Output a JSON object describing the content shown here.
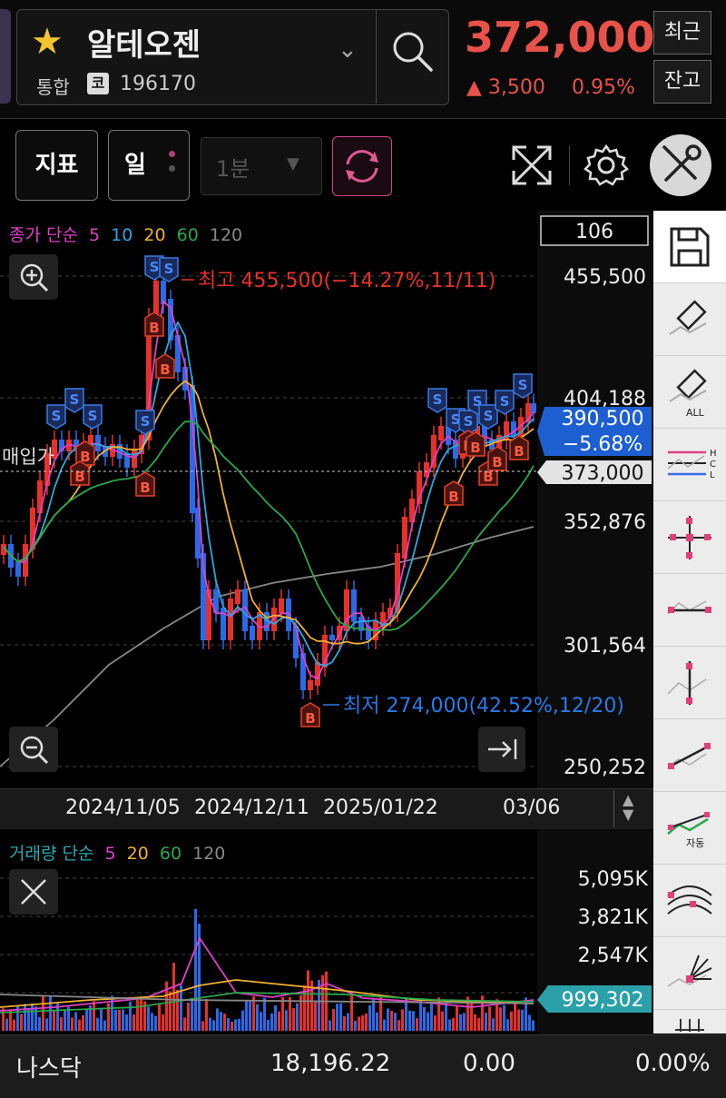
{
  "header": {
    "stock_name": "알테오젠",
    "market": "통합",
    "code_badge": "코",
    "code": "196170",
    "price": "372,000",
    "change": "▲ 3,500",
    "change_pct": "0.95%",
    "recent_btn": "최근",
    "balance_btn": "잔고"
  },
  "toolbar": {
    "indicator_btn": "지표",
    "period_btn": "일",
    "interval_select": "1분"
  },
  "chart": {
    "ma_label_prefix": "종가 단순",
    "ma_periods": [
      "5",
      "10",
      "20",
      "60",
      "120"
    ],
    "ma_colors": [
      "#e040c8",
      "#2aa8e0",
      "#f0b030",
      "#29a84a",
      "#888888"
    ],
    "top_count": "106",
    "price_ticks": [
      "455,500",
      "404,188",
      "352,876",
      "301,564",
      "250,252"
    ],
    "high_label": "최고 455,500(−14.27%,11/11)",
    "low_label": "최저 274,000(42.52%,12/20)",
    "current_tag_price": "390,500",
    "current_tag_pct": "−5.68%",
    "buy_price_label": "매입가",
    "buy_price_tag": "373,000",
    "dates": [
      "2024/11/05",
      "2024/12/11",
      "2025/01/22",
      "03/06"
    ]
  },
  "volume": {
    "label_prefix": "거래량 단순",
    "ma_periods": [
      "5",
      "20",
      "60",
      "120"
    ],
    "ticks": [
      "5,095K",
      "3,821K",
      "2,547K"
    ],
    "current_tag": "999,302"
  },
  "bottom": {
    "index_name": "나스닥",
    "index_value": "18,196.22",
    "index_change": "0.00",
    "index_pct": "0.00%"
  },
  "right_tools": [
    "save-icon",
    "eraser-icon",
    "eraser-all-icon",
    "hcl-lines-icon",
    "crosshair-icon",
    "horizontal-line-icon",
    "vertical-line-icon",
    "trend-line-icon",
    "auto-trend-icon",
    "arc-icon",
    "fan-icon"
  ],
  "right_tool_texts": {
    "eraser_all": "ALL",
    "auto": "자동",
    "h": "H",
    "c": "C",
    "l": "L"
  }
}
